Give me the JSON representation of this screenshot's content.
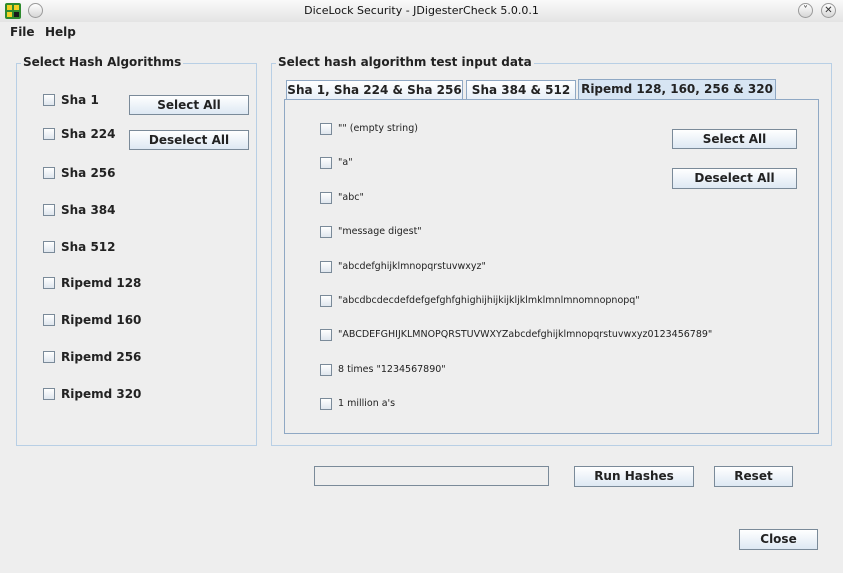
{
  "window": {
    "title": "DiceLock Security - JDigesterCheck 5.0.0.1",
    "minimize_glyph": "˅",
    "close_glyph": "✕"
  },
  "menu": {
    "items": [
      "File",
      "Help"
    ]
  },
  "left_panel": {
    "title": "Select Hash Algorithms",
    "algorithms": [
      "Sha 1",
      "Sha 224",
      "Sha 256",
      "Sha 384",
      "Sha 512",
      "Ripemd 128",
      "Ripemd 160",
      "Ripemd 256",
      "Ripemd 320"
    ],
    "select_all_label": "Select All",
    "deselect_all_label": "Deselect All"
  },
  "right_panel": {
    "title": "Select hash algorithm test input data",
    "tabs": [
      "Sha 1, Sha 224 & Sha 256",
      "Sha 384 & 512",
      "Ripemd 128, 160, 256 & 320"
    ],
    "active_tab": 2,
    "inputs": [
      "\"\" (empty string)",
      "\"a\"",
      "\"abc\"",
      "\"message digest\"",
      "\"abcdefghijklmnopqrstuvwxyz\"",
      "\"abcdbcdecdefdefgefghfghighijhijkijkljklmklmnlmnomnopnopq\"",
      "\"ABCDEFGHIJKLMNOPQRSTUVWXYZabcdefghijklmnopqrstuvwxyz0123456789\"",
      "8 times \"1234567890\"",
      "1 million a's"
    ],
    "select_all_label": "Select All",
    "deselect_all_label": "Deselect All"
  },
  "actions": {
    "progress_value": 0,
    "run_label": "Run Hashes",
    "reset_label": "Reset",
    "close_label": "Close"
  },
  "colors": {
    "border_accent": "#b8cfe5",
    "button_top": "#ffffff",
    "button_bottom": "#dde8f3"
  }
}
